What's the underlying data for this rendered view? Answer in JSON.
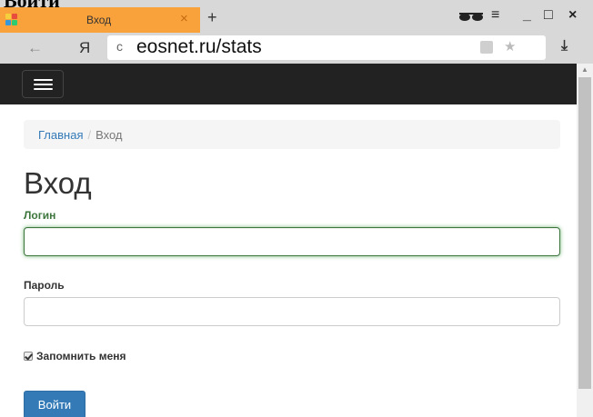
{
  "overlay": {
    "text": "Войти"
  },
  "browser": {
    "tab_title": "Вход",
    "tab_close": "×",
    "new_tab": "+",
    "menu": "≡",
    "minimize": "_",
    "maximize": "□",
    "close": "×",
    "back": "←",
    "yandex": "Я",
    "reload": "c",
    "url": "eosnet.ru/stats",
    "star": "★",
    "download": "⤓",
    "tab_color": "#f9a23b"
  },
  "navbar": {
    "background": "#222222"
  },
  "breadcrumb": {
    "home": "Главная",
    "separator": "/",
    "current": "Вход"
  },
  "page": {
    "title": "Вход",
    "login_label": "Логин",
    "login_value": "",
    "password_label": "Пароль",
    "password_value": "",
    "remember_label": "Запомнить меня",
    "remember_checked": true,
    "submit_label": "Войти",
    "accent": "#337ab7",
    "success": "#3c763d"
  },
  "scrollbar": {
    "up_arrow": "▲"
  }
}
